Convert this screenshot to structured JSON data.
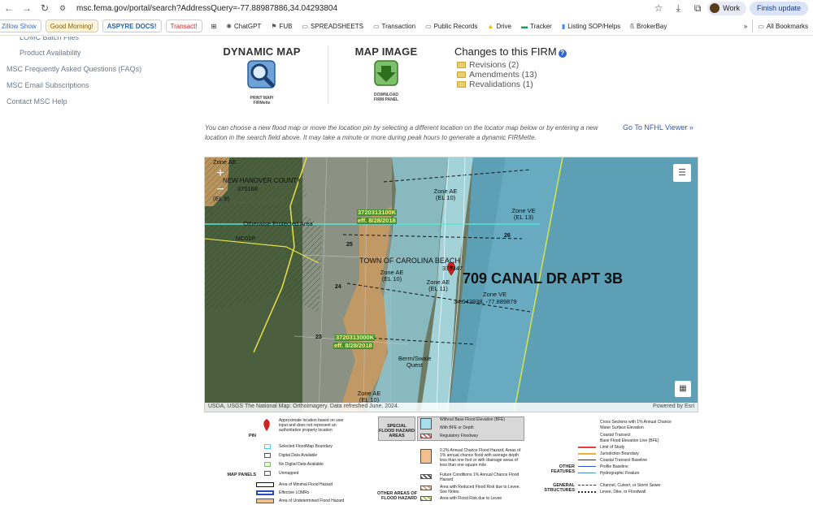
{
  "browser": {
    "url": "msc.fema.gov/portal/search?AddressQuery=-77.88987886,34.04293804",
    "profile": "Work",
    "finish_update": "Finish update"
  },
  "bookmarks": [
    {
      "label": "Zillow Show",
      "style": "pill",
      "color": "#2d6fd2"
    },
    {
      "label": "Good Morning!",
      "style": "pill",
      "color": "#b07a00"
    },
    {
      "label": "ASPYRE DOCS!",
      "style": "pill",
      "color": "#1c5fb7"
    },
    {
      "label": "Transact!",
      "style": "pill",
      "color": "#c62828"
    },
    {
      "label": "ChatGPT",
      "style": "plain"
    },
    {
      "label": "FUB",
      "style": "plain"
    },
    {
      "label": "SPREADSHEETS",
      "style": "plain"
    },
    {
      "label": "Transaction",
      "style": "plain"
    },
    {
      "label": "Public Records",
      "style": "plain"
    },
    {
      "label": "Drive",
      "style": "plain"
    },
    {
      "label": "Tracker",
      "style": "plain"
    },
    {
      "label": "Listing SOP/Helps",
      "style": "plain"
    },
    {
      "label": "BrokerBay",
      "style": "plain"
    }
  ],
  "all_bookmarks": "All Bookmarks",
  "sidebar": {
    "items": [
      "LOMC Batch Files",
      "Product Availability",
      "MSC Frequently Asked Questions (FAQs)",
      "MSC Email Subscriptions",
      "Contact MSC Help"
    ]
  },
  "tools": {
    "dynamic_map": {
      "title": "DYNAMIC MAP",
      "caption": "PRINT MAP/ FIRMette"
    },
    "map_image": {
      "title": "MAP IMAGE",
      "caption": "DOWNLOAD FIRM PANEL"
    }
  },
  "changes": {
    "title": "Changes to this FIRM",
    "items": [
      "Revisions (2)",
      "Amendments (13)",
      "Revalidations (1)"
    ]
  },
  "note": "You can choose a new flood map or move the location pin by selecting a different location on the locator map below or by entering a new location in the search field above. It may take a minute or more during peak hours to generate a dynamic FIRMette.",
  "nfhl_link": "Go To NFHL Viewer »",
  "map": {
    "address": "709 CANAL DR APT 3B",
    "coords": "34.042938, -77.889879",
    "labels": {
      "county": "NEW HANOVER COUNTY",
      "county_code": "370168",
      "town": "TOWN OF CAROLINA BEACH",
      "town_code": "375347",
      "panel_a": "3720313100K",
      "panel_a_eff": "eff. 8/28/2018",
      "panel_b": "3720313000K",
      "panel_b_eff": "eff. 8/28/2018",
      "protected": "Otherwise Protected Area",
      "protected_code": "NC01P",
      "zone_ae_10a": "Zone AE (EL 10)",
      "zone_ve_13": "Zone VE (EL 13)",
      "zone_ae_10b": "Zone AE (EL 10)",
      "zone_ae_11": "Zone AE (EL 11)",
      "zone_ve_b": "Zone VE",
      "zone_ae_10c": "Zone AE (EL 10)",
      "zone_ae_tl": "Zone AE",
      "zone_tl_el": "(EL 9)",
      "berm": "Berm/Swale Quest",
      "t24": "24",
      "t25": "25",
      "t26": "26",
      "t23": "23"
    },
    "attribution_left": "USDA, USGS The National Map: Orthoimagery. Data refreshed June, 2024.",
    "attribution_right": "Powered by Esri",
    "zoom_in": "+",
    "zoom_out": "−"
  },
  "legend": {
    "pin_header": "PIN",
    "pin_text": "Approximate location based on user input and does not represent an authoritative property location",
    "map_panels_header": "MAP PANELS",
    "panels": [
      "Selected FloodMap Boundary",
      "Digital Data Available",
      "No Digital Data Available",
      "Unmapped"
    ],
    "panels_more": [
      "Area of Minimal Flood Hazard",
      "Effective LOMRs",
      "Area of Undetermined Flood Hazard"
    ],
    "sfha_header": "SPECIAL FLOOD HAZARD AREAS",
    "sfha": [
      "Without Base Flood Elevation (BFE)",
      "With BFE or Depth",
      "Regulatory Floodway"
    ],
    "other_header": "OTHER AREAS OF FLOOD HAZARD",
    "other": [
      "0.2% Annual Chance Flood Hazard, Areas of 1% annual chance flood with average depth less than one foot or with drainage areas of less than one square mile",
      "Future Conditions 1% Annual Chance Flood Hazard",
      "Area with Reduced Flood Risk due to Levee. See Notes.",
      "Area with Flood Risk due to Levee"
    ],
    "features_header": "OTHER FEATURES",
    "features": [
      "Cross Sections with 1% Annual Chance",
      "Water Surface Elevation",
      "Coastal Transect",
      "Base Flood Elevation Line (BFE)",
      "Limit of Study",
      "Jurisdiction Boundary",
      "Coastal Transect Baseline",
      "Profile Baseline",
      "Hydrographic Feature"
    ],
    "structures_header": "GENERAL STRUCTURES",
    "structures": [
      "Channel, Culvert, or Storm Sewer",
      "Levee, Dike, or Floodwall"
    ],
    "colors": {
      "sfha": "#a6dff0",
      "shaded": "#f2c08c",
      "lomr": "#2a49c4",
      "limit": "#e04040",
      "jurisdiction": "#e9b23a"
    }
  },
  "colors": {
    "link": "#2e5bb8",
    "ocean": "#5a9bb2",
    "ve_zone": "#6fb4c9",
    "ae_zone": "#8cc6d4",
    "x_shaded": "#d1a070"
  }
}
